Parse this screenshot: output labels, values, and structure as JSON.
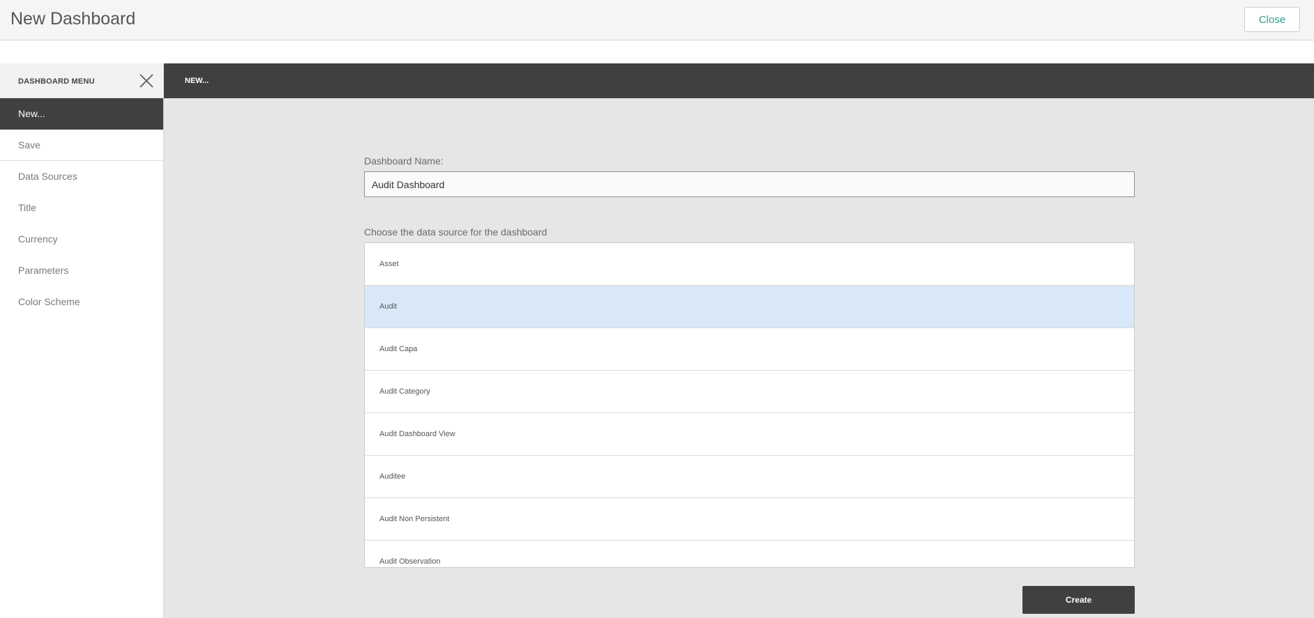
{
  "header": {
    "title": "New Dashboard",
    "close_label": "Close"
  },
  "sidebar": {
    "title": "DASHBOARD MENU",
    "close_icon": "close-icon",
    "items": [
      {
        "label": "New..."
      },
      {
        "label": "Save"
      },
      {
        "label": "Data Sources"
      },
      {
        "label": "Title"
      },
      {
        "label": "Currency"
      },
      {
        "label": "Parameters"
      },
      {
        "label": "Color Scheme"
      }
    ]
  },
  "main": {
    "section_title": "NEW...",
    "name_label": "Dashboard Name:",
    "name_value": "Audit Dashboard",
    "source_label": "Choose the data source for the dashboard",
    "sources": [
      {
        "label": "Asset"
      },
      {
        "label": "Audit"
      },
      {
        "label": "Audit Capa"
      },
      {
        "label": "Audit Category"
      },
      {
        "label": "Audit Dashboard View"
      },
      {
        "label": "Auditee"
      },
      {
        "label": "Audit Non Persistent"
      },
      {
        "label": "Audit Observation"
      }
    ],
    "selected_source": "Audit",
    "create_label": "Create"
  },
  "colors": {
    "dark": "#404040",
    "accent": "#2e9e8c",
    "selected_row": "#d9e8f8",
    "panel_bg": "#e6e6e6"
  }
}
